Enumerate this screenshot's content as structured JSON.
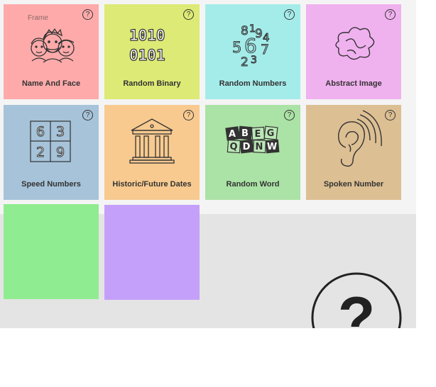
{
  "tiles": [
    {
      "id": "name-and-face",
      "label": "Name And Face",
      "bg": "#ffaaaa",
      "icon": "faces-icon",
      "note": "Frame"
    },
    {
      "id": "random-binary",
      "label": "Random Binary",
      "bg": "#ddea75",
      "icon": "binary-icon",
      "binary": [
        "1010",
        "0101"
      ]
    },
    {
      "id": "random-numbers",
      "label": "Random Numbers",
      "bg": "#a4ecea",
      "icon": "numbers-cloud-icon",
      "digits": [
        "8",
        "1",
        "9",
        "4",
        "5",
        "6",
        "7",
        "2",
        "3"
      ]
    },
    {
      "id": "abstract-image",
      "label": "Abstract Image",
      "bg": "#f0b1ef",
      "icon": "abstract-shape-icon"
    },
    {
      "id": "speed-numbers",
      "label": "Speed Numbers",
      "bg": "#a6c3d9",
      "icon": "grid-numbers-icon",
      "digits": [
        "6",
        "3",
        "2",
        "9"
      ]
    },
    {
      "id": "historic-future-dates",
      "label": "Historic/Future Dates",
      "bg": "#f8ca90",
      "icon": "temple-icon"
    },
    {
      "id": "random-word",
      "label": "Random Word",
      "bg": "#abe2a5",
      "icon": "letter-tiles-icon",
      "letters": [
        "A",
        "B",
        "E",
        "G",
        "Q",
        "D",
        "N",
        "W"
      ]
    },
    {
      "id": "spoken-number",
      "label": "Spoken Number",
      "bg": "#dcbf93",
      "icon": "ear-icon"
    }
  ],
  "extra_tiles": [
    {
      "bg": "#90ec90"
    },
    {
      "bg": "#c4a0fa"
    }
  ],
  "help_glyph": "?",
  "big_help_glyph": "?"
}
